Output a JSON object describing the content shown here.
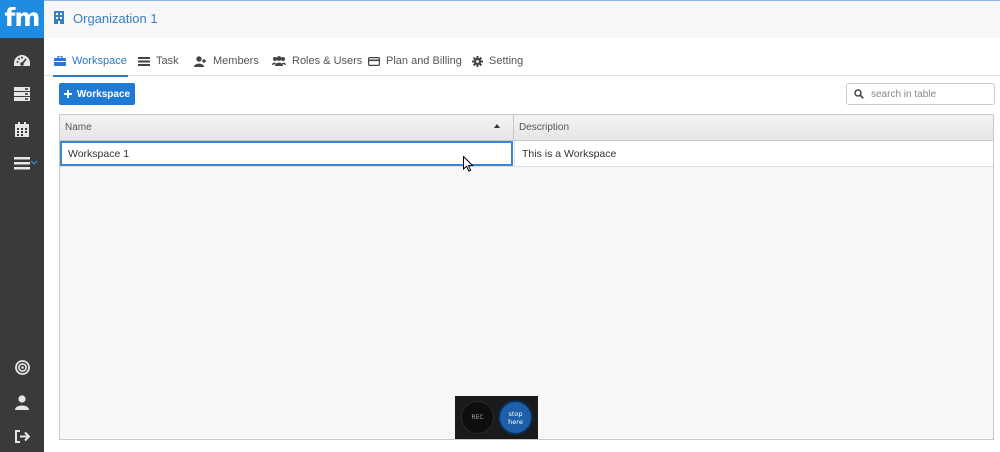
{
  "app": {
    "logo_text": "fm"
  },
  "header": {
    "org_title": "Organization 1"
  },
  "sidebar": {
    "items": [
      {
        "icon": "dashboard-icon"
      },
      {
        "icon": "server-icon"
      },
      {
        "icon": "calendar-icon"
      },
      {
        "icon": "menu-icon"
      },
      {
        "icon": "target-icon"
      },
      {
        "icon": "user-icon"
      },
      {
        "icon": "logout-icon"
      }
    ]
  },
  "tabs": [
    {
      "label": "Workspace",
      "icon": "briefcase-icon",
      "active": true
    },
    {
      "label": "Task",
      "icon": "list-icon"
    },
    {
      "label": "Members",
      "icon": "add-user-icon"
    },
    {
      "label": "Roles & Users",
      "icon": "users-icon"
    },
    {
      "label": "Plan and Billing",
      "icon": "credit-card-icon"
    },
    {
      "label": "Setting",
      "icon": "gear-icon"
    }
  ],
  "toolbar": {
    "add_button_label": "Workspace",
    "search_placeholder": "search in table",
    "search_value": ""
  },
  "table": {
    "columns": [
      "Name",
      "Description"
    ],
    "rows": [
      {
        "name": "Workspace 1",
        "description": "This is a Workspace"
      }
    ]
  },
  "recorder": {
    "rec_label": "REC",
    "stop_label": "stop here"
  },
  "colors": {
    "accent": "#1f7ad6",
    "sidebar": "#3a3a3a",
    "logo": "#1f8be0"
  }
}
